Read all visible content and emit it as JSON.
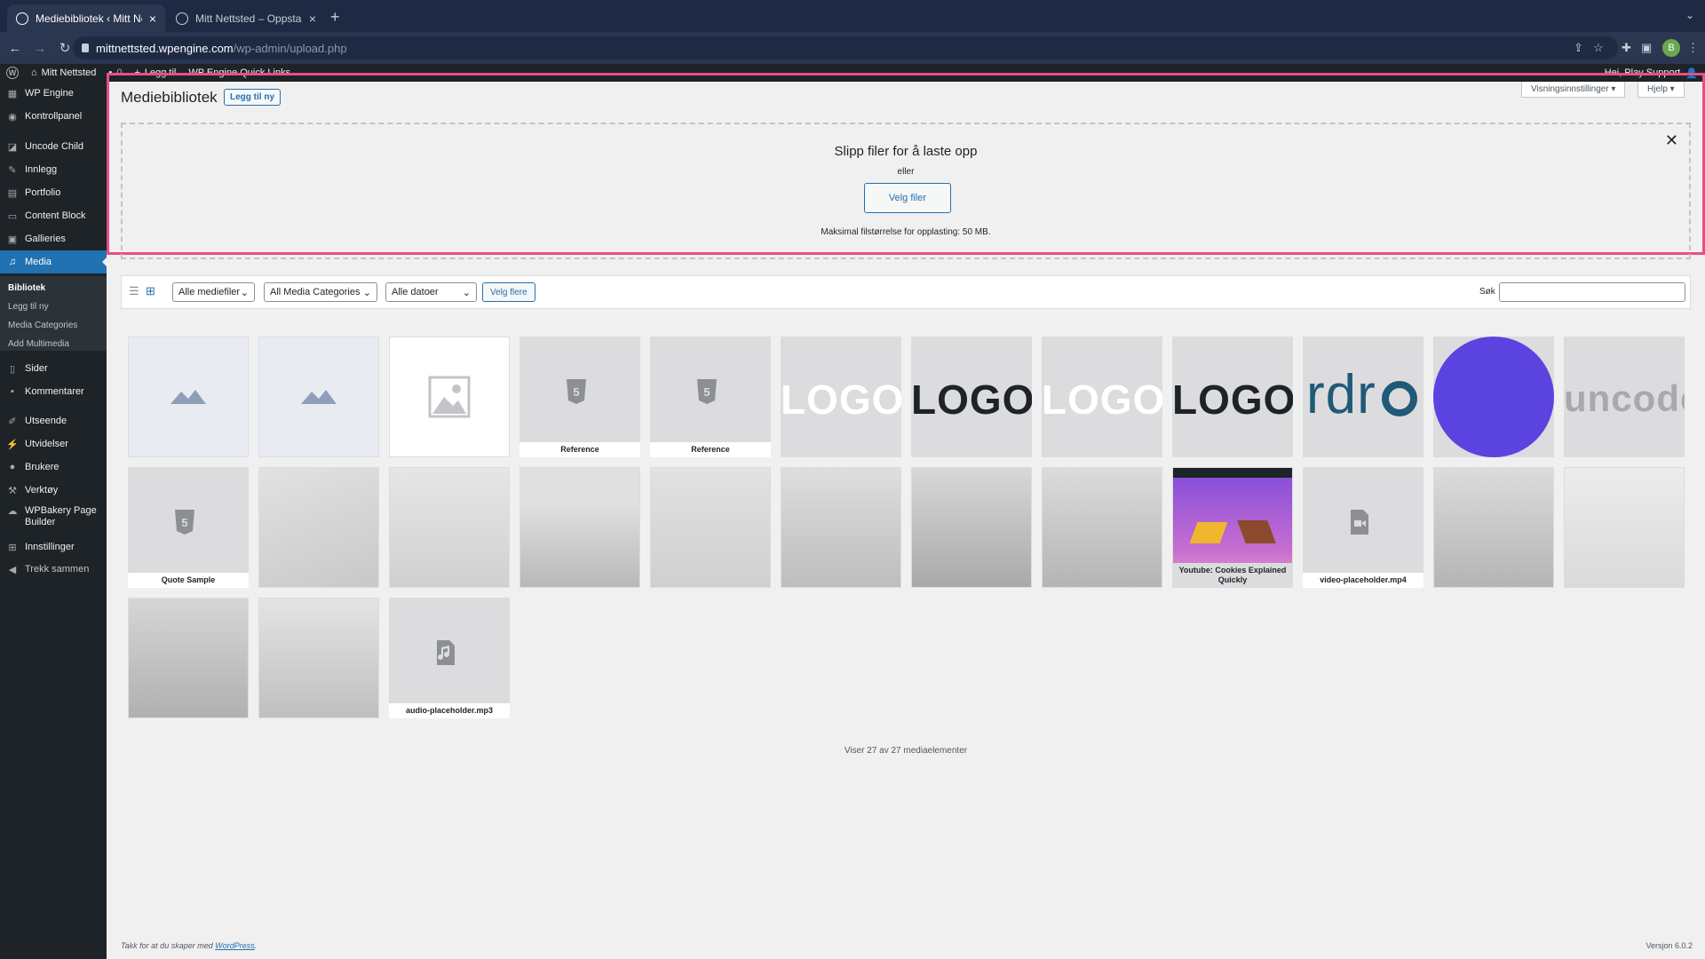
{
  "browser": {
    "tabs": [
      {
        "label": "Mediebibliotek ‹ Mitt Nettsted"
      },
      {
        "label": "Mitt Nettsted – Oppstartsinstallasjon"
      }
    ],
    "url_host": "mittnettsted.wpengine.com",
    "url_path": "/wp-admin/upload.php",
    "profile_initial": "B"
  },
  "adminbar": {
    "site": "Mitt Nettsted",
    "comments": "0",
    "new": "Legg til",
    "quicklinks": "WP Engine Quick Links",
    "greeting": "Hei, Play Support"
  },
  "sidebar": {
    "items": [
      {
        "label": "WP Engine"
      },
      {
        "label": "Kontrollpanel"
      },
      {
        "label": "Uncode Child"
      },
      {
        "label": "Innlegg"
      },
      {
        "label": "Portfolio"
      },
      {
        "label": "Content Block"
      },
      {
        "label": "Gallieries"
      },
      {
        "label": "Media"
      },
      {
        "label": "Sider"
      },
      {
        "label": "Kommentarer"
      },
      {
        "label": "Utseende"
      },
      {
        "label": "Utvidelser"
      },
      {
        "label": "Brukere"
      },
      {
        "label": "Verktøy"
      },
      {
        "label": "WPBakery Page"
      },
      {
        "label": "Builder"
      },
      {
        "label": "Innstillinger"
      },
      {
        "label": "Trekk sammen"
      }
    ],
    "submenu": [
      "Bibliotek",
      "Legg til ny",
      "Media Categories",
      "Add Multimedia"
    ]
  },
  "page": {
    "title": "Mediebibliotek",
    "add_new": "Legg til ny",
    "screen_options": "Visningsinnstillinger ▾",
    "help": "Hjelp ▾"
  },
  "dropzone": {
    "title": "Slipp filer for å laste opp",
    "or": "eller",
    "button": "Velg filer",
    "max": "Maksimal filstørrelse for opplasting: 50 MB."
  },
  "filters": {
    "type": "Alle mediefiler",
    "category": "All Media Categories",
    "date": "Alle datoer",
    "bulk": "Velg flere",
    "search_label": "Søk"
  },
  "tiles": {
    "logo": "LOGO",
    "rdr": "rdr",
    "uncode": "uncode",
    "cap_reference": "Reference",
    "cap_quote": "Quote Sample",
    "cap_youtube": "Youtube: Cookies Explained Quickly",
    "cap_video": "video-placeholder.mp4",
    "cap_audio": "audio-placeholder.mp3"
  },
  "count": "Viser 27 av 27 mediaelementer",
  "footer": {
    "prefix": "Takk for at du skaper med ",
    "link": "WordPress",
    "suffix": "."
  },
  "version": "Versjon 6.0.2",
  "colors": {
    "accent": "#2271b1",
    "highlight": "#ea4c89",
    "circle": "#5b43e0",
    "rdr": "#1f5a78"
  }
}
